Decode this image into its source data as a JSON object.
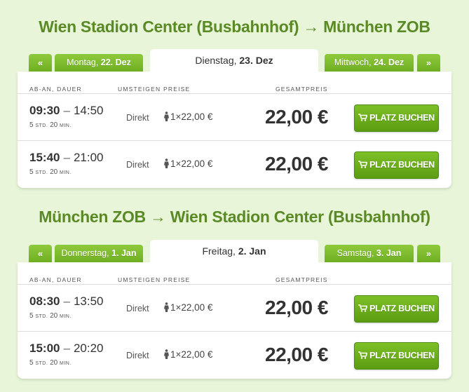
{
  "routes": [
    {
      "title": "Wien Stadion Center (Busbahnhof) → München ZOB",
      "tabs": {
        "prev_arrow": "«",
        "next_arrow": "»",
        "prev_day": {
          "weekday": "Montag,",
          "date": "22. Dez"
        },
        "active_day": {
          "weekday": "Dienstag,",
          "date": "23. Dez"
        },
        "next_day": {
          "weekday": "Mittwoch,",
          "date": "24. Dez"
        }
      },
      "columns": {
        "time": "AB-AN, DAUER",
        "transfer": "UMSTEIGEN",
        "prices": "PREISE",
        "total": "GESAMTPREIS"
      },
      "rows": [
        {
          "dep": "09:30",
          "dash": "–",
          "arr": "14:50",
          "dur_h": "5",
          "dur_h_unit": "STD.",
          "dur_m": "20",
          "dur_m_unit": "MIN.",
          "transfer": "Direkt",
          "per_person": "1×22,00 €",
          "total": "22,00 €",
          "button": "PLATZ BUCHEN"
        },
        {
          "dep": "15:40",
          "dash": "–",
          "arr": "21:00",
          "dur_h": "5",
          "dur_h_unit": "STD.",
          "dur_m": "20",
          "dur_m_unit": "MIN.",
          "transfer": "Direkt",
          "per_person": "1×22,00 €",
          "total": "22,00 €",
          "button": "PLATZ BUCHEN"
        }
      ]
    },
    {
      "title": "München ZOB → Wien Stadion Center (Busbahnhof)",
      "tabs": {
        "prev_arrow": "«",
        "next_arrow": "»",
        "prev_day": {
          "weekday": "Donnerstag,",
          "date": "1. Jan"
        },
        "active_day": {
          "weekday": "Freitag,",
          "date": "2. Jan"
        },
        "next_day": {
          "weekday": "Samstag,",
          "date": "3. Jan"
        }
      },
      "columns": {
        "time": "AB-AN, DAUER",
        "transfer": "UMSTEIGEN",
        "prices": "PREISE",
        "total": "GESAMTPREIS"
      },
      "rows": [
        {
          "dep": "08:30",
          "dash": "–",
          "arr": "13:50",
          "dur_h": "5",
          "dur_h_unit": "STD.",
          "dur_m": "20",
          "dur_m_unit": "MIN.",
          "transfer": "Direkt",
          "per_person": "1×22,00 €",
          "total": "22,00 €",
          "button": "PLATZ BUCHEN"
        },
        {
          "dep": "15:00",
          "dash": "–",
          "arr": "20:20",
          "dur_h": "5",
          "dur_h_unit": "STD.",
          "dur_m": "20",
          "dur_m_unit": "MIN.",
          "transfer": "Direkt",
          "per_person": "1×22,00 €",
          "total": "22,00 €",
          "button": "PLATZ BUCHEN"
        }
      ]
    }
  ],
  "colors": {
    "accent": "#5a8a25",
    "button": "#6fae22",
    "background": "#e8f5d8"
  },
  "icons": {
    "person": "person-icon",
    "cart": "cart-icon"
  }
}
